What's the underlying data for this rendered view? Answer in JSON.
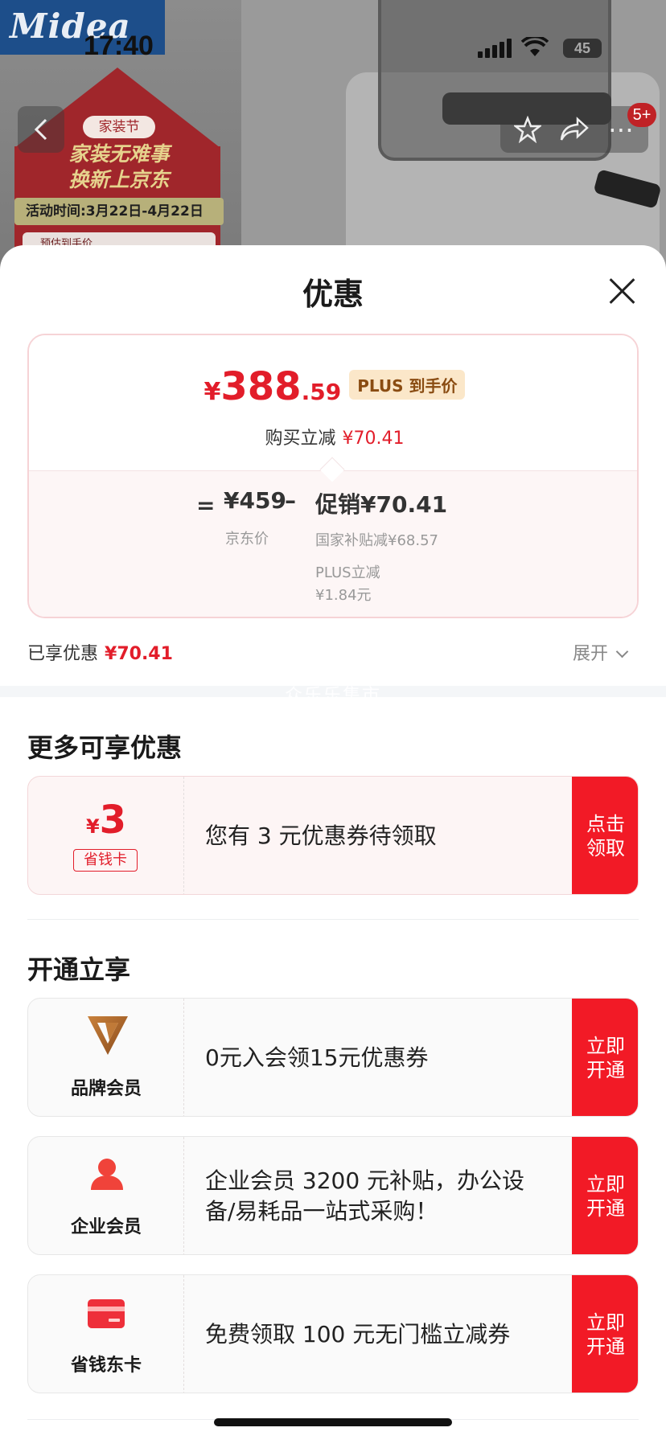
{
  "background": {
    "brand_logo": "Midea",
    "festival_badge": "家装节",
    "slogan_line1": "家装无难事",
    "slogan_line2": "换新上京东",
    "activity_time": "活动时间:3月22日-4月22日",
    "estimate_label": "预估到手价",
    "cart_badge": "5+"
  },
  "status_bar": {
    "time": "17:40",
    "battery": "45"
  },
  "sheet": {
    "title": "优惠",
    "price": {
      "currency": "¥",
      "integer": "388",
      "decimal": ".59",
      "tag": "PLUS 到手价",
      "reduce_label": "购买立减",
      "reduce_value": "¥70.41"
    },
    "calc": {
      "equals": "=",
      "jd_price": "¥459",
      "jd_label": "京东价",
      "minus": "–",
      "promo": "促销¥70.41",
      "subsidy": "国家补贴减¥68.57",
      "plus_label": "PLUS立减",
      "plus_value": "¥1.84元"
    },
    "enjoyed_label": "已享优惠",
    "enjoyed_value": "¥70.41",
    "expand_label": "展开",
    "watermark": "众乐乐集市",
    "more_title": "更多可享优惠",
    "coupon": {
      "currency": "¥",
      "amount": "3",
      "card_label": "省钱卡",
      "text": "您有 3 元优惠券待领取",
      "button": "点击领取"
    },
    "open_title": "开通立享",
    "memberships": [
      {
        "name": "品牌会员",
        "text": "0元入会领15元优惠券",
        "button": "立即开通"
      },
      {
        "name": "企业会员",
        "text": "企业会员 3200 元补贴，办公设备/易耗品一站式采购！",
        "button": "立即开通"
      },
      {
        "name": "省钱东卡",
        "text": "免费领取 100 元无门槛立减券",
        "button": "立即开通"
      }
    ]
  },
  "colors": {
    "accent_red": "#f21a26",
    "price_red": "#e21d2a",
    "plus_tag_bg": "#fbe7c9"
  }
}
